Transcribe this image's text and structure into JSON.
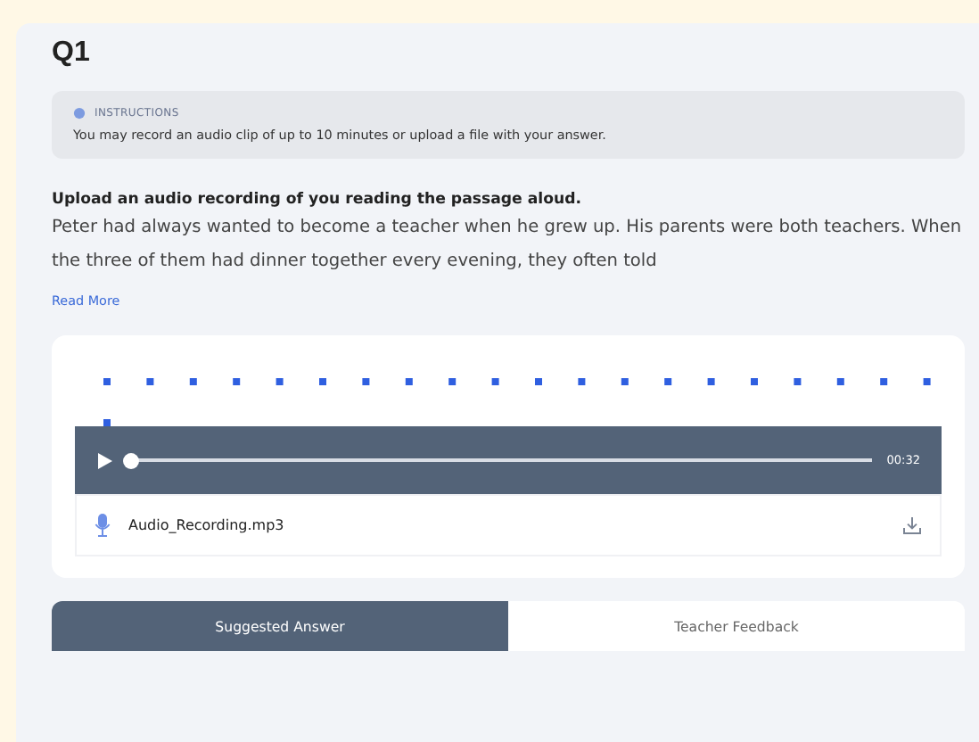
{
  "question": {
    "title": "Q1",
    "instructions": {
      "label": "INSTRUCTIONS",
      "text": "You may record an audio clip of up to 10 minutes or upload a file with your answer."
    },
    "prompt": "Upload an audio recording of you reading the passage aloud.",
    "passage": "Peter had always wanted to become a teacher when he grew up. His parents were both teachers. When the three of them had dinner together every evening, they often told",
    "read_more": "Read More",
    "player": {
      "level": 0.0,
      "time": "00:32"
    },
    "file": {
      "name": "Audio_Recording.mp3"
    },
    "tabs": [
      {
        "label": "Suggested Answer",
        "selected": true
      },
      {
        "label": "Teacher Feedback",
        "selected": false
      }
    ]
  }
}
